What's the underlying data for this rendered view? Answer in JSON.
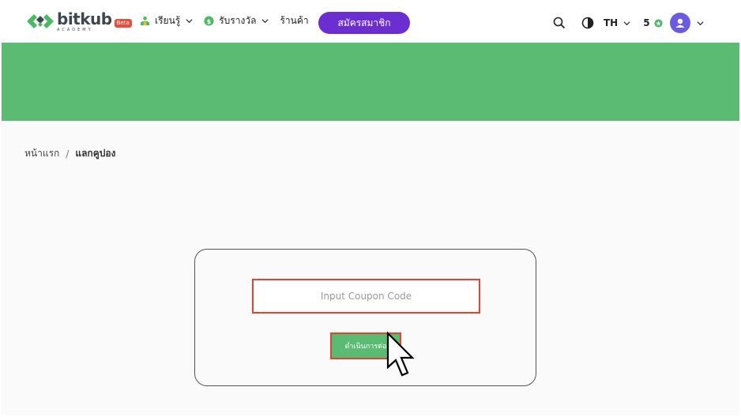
{
  "header": {
    "logo_text": "bitkub",
    "logo_sub": "ACADEMY",
    "beta_badge": "Beta",
    "nav": [
      {
        "label": "เรียนรู้",
        "icon": "learn-icon",
        "has_dropdown": true
      },
      {
        "label": "รับรางวัล",
        "icon": "reward-coin-icon",
        "has_dropdown": true
      },
      {
        "label": "ร้านค้า",
        "icon": "",
        "has_dropdown": false
      }
    ],
    "signup_label": "สมัครสมาชิก",
    "language": "TH",
    "points": "5",
    "colors": {
      "brand_green": "#5cbb72",
      "signup_purple": "#6b2ed1",
      "avatar": "#6b5be0",
      "highlight_red": "#e2452f"
    }
  },
  "breadcrumb": {
    "home": "หน้าแรก",
    "separator": "/",
    "current": "แลกคูปอง"
  },
  "coupon": {
    "input_value": "",
    "input_placeholder": "Input Coupon Code",
    "submit_label": "ดำเนินการต่อ"
  }
}
